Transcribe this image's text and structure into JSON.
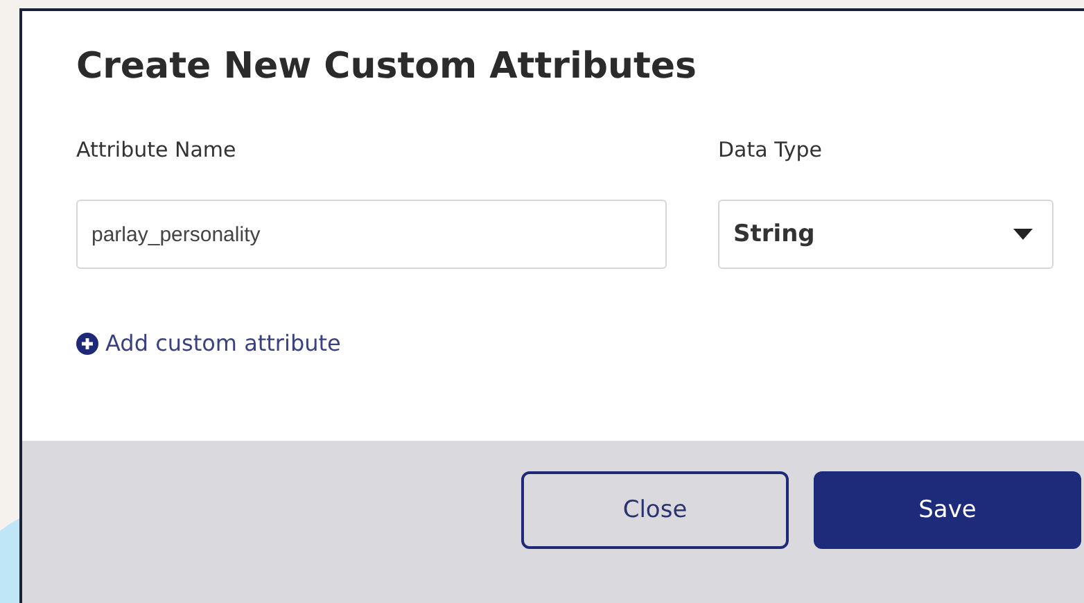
{
  "dialog": {
    "title": "Create New Custom Attributes",
    "fields": [
      {
        "kind": "text",
        "label": "Attribute Name",
        "value": "parlay_personality"
      },
      {
        "kind": "select",
        "label": "Data Type",
        "value": "String"
      }
    ],
    "add_link": "Add custom attribute",
    "buttons": [
      {
        "kind": "secondary",
        "label": "Close"
      },
      {
        "kind": "primary",
        "label": "Save"
      }
    ]
  }
}
